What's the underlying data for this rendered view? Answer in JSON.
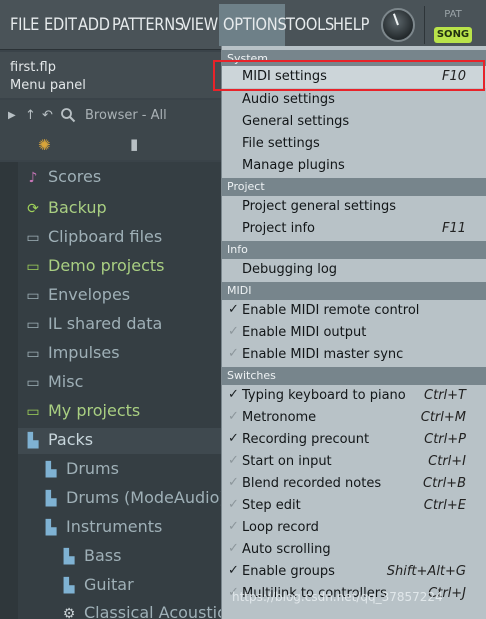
{
  "menubar": {
    "items": [
      "FILE",
      "EDIT",
      "ADD",
      "PATTERNS",
      "VIEW",
      "OPTIONS",
      "TOOLS",
      "HELP"
    ],
    "pat_label": "PAT",
    "song_label": "SONG",
    "active": "OPTIONS"
  },
  "hint": {
    "file": "first.flp",
    "panel": "Menu panel"
  },
  "browser": {
    "title": "Browser - All",
    "icons": [
      "arrow-right-icon",
      "arrow-up-icon",
      "undo-icon",
      "search-icon",
      "snap-icon",
      "document-icon"
    ]
  },
  "tree": {
    "items": [
      {
        "label": "Scores",
        "icon": "music-note-icon"
      },
      {
        "label": "Backup",
        "icon": "folder-backup-icon"
      },
      {
        "label": "Clipboard files",
        "icon": "folder-icon"
      },
      {
        "label": "Demo projects",
        "icon": "folder-icon"
      },
      {
        "label": "Envelopes",
        "icon": "folder-icon"
      },
      {
        "label": "IL shared data",
        "icon": "folder-icon"
      },
      {
        "label": "Impulses",
        "icon": "folder-icon"
      },
      {
        "label": "Misc",
        "icon": "folder-icon"
      },
      {
        "label": "My projects",
        "icon": "folder-icon"
      },
      {
        "label": "Packs",
        "icon": "pack-icon"
      },
      {
        "label": "Drums",
        "icon": "pack-icon"
      },
      {
        "label": "Drums (ModeAudio)",
        "icon": "pack-icon"
      },
      {
        "label": "Instruments",
        "icon": "pack-icon"
      },
      {
        "label": "Bass",
        "icon": "pack-icon"
      },
      {
        "label": "Guitar",
        "icon": "pack-icon"
      },
      {
        "label": "Classical Acoustic",
        "icon": "gear-icon"
      }
    ]
  },
  "menu": {
    "sections": {
      "system": "System",
      "project": "Project",
      "info": "Info",
      "midi": "MIDI",
      "switches": "Switches"
    },
    "items": {
      "midi_settings": {
        "label": "MIDI settings",
        "shortcut": "F10"
      },
      "audio_settings": {
        "label": "Audio settings"
      },
      "general_settings": {
        "label": "General settings"
      },
      "file_settings": {
        "label": "File settings"
      },
      "manage_plugins": {
        "label": "Manage plugins"
      },
      "project_general": {
        "label": "Project general settings"
      },
      "project_info": {
        "label": "Project info",
        "shortcut": "F11"
      },
      "debugging_log": {
        "label": "Debugging log"
      },
      "midi_remote": {
        "label": "Enable MIDI remote control",
        "checked": true
      },
      "midi_output": {
        "label": "Enable MIDI output",
        "checked": false
      },
      "midi_master_sync": {
        "label": "Enable MIDI master sync",
        "checked": false
      },
      "typing_keyboard": {
        "label": "Typing keyboard to piano",
        "shortcut": "Ctrl+T",
        "checked": true
      },
      "metronome": {
        "label": "Metronome",
        "shortcut": "Ctrl+M",
        "checked": false
      },
      "recording_precount": {
        "label": "Recording precount",
        "shortcut": "Ctrl+P",
        "checked": true
      },
      "start_on_input": {
        "label": "Start on input",
        "shortcut": "Ctrl+I",
        "checked": false
      },
      "blend_recorded": {
        "label": "Blend recorded notes",
        "shortcut": "Ctrl+B",
        "checked": false
      },
      "step_edit": {
        "label": "Step edit",
        "shortcut": "Ctrl+E",
        "checked": false
      },
      "loop_record": {
        "label": "Loop record",
        "checked": false
      },
      "auto_scrolling": {
        "label": "Auto scrolling",
        "checked": false
      },
      "enable_groups": {
        "label": "Enable groups",
        "shortcut": "Shift+Alt+G",
        "checked": true
      },
      "multilink": {
        "label": "Multilink to controllers",
        "shortcut": "Ctrl+J",
        "checked": false
      }
    }
  },
  "watermark": "https://blog.csdn.net/qq_37857224",
  "colors": {
    "highlight_box": "#e8232a",
    "song_button": "#b9e34a",
    "menu_bg": "#b8c2c7",
    "section_header": "#77858c"
  }
}
